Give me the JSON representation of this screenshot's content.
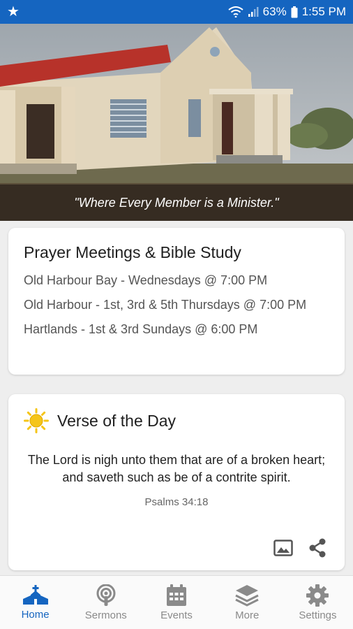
{
  "status_bar": {
    "notification_icon": "star-icon",
    "battery": "63%",
    "time": "1:55 PM"
  },
  "hero": {
    "tagline": "\"Where Every Member is a Minister.\""
  },
  "prayer_card": {
    "title": "Prayer Meetings & Bible Study",
    "items": [
      "Old Harbour Bay - Wednesdays @ 7:00 PM",
      "Old Harbour - 1st, 3rd & 5th Thursdays @ 7:00 PM",
      "Hartlands - 1st & 3rd Sundays @ 6:00 PM"
    ]
  },
  "verse_card": {
    "title": "Verse of the Day",
    "verse": "The Lord is nigh unto them that are of a broken heart; and saveth such as be of a contrite spirit.",
    "reference": "Psalms 34:18"
  },
  "tabs": [
    {
      "label": "Home",
      "icon": "church-icon",
      "active": true
    },
    {
      "label": "Sermons",
      "icon": "podcast-icon",
      "active": false
    },
    {
      "label": "Events",
      "icon": "calendar-icon",
      "active": false
    },
    {
      "label": "More",
      "icon": "layers-icon",
      "active": false
    },
    {
      "label": "Settings",
      "icon": "gear-icon",
      "active": false
    }
  ],
  "colors": {
    "primary": "#1565c0",
    "inactive": "#8a8a8a",
    "background": "#eeeeee"
  }
}
